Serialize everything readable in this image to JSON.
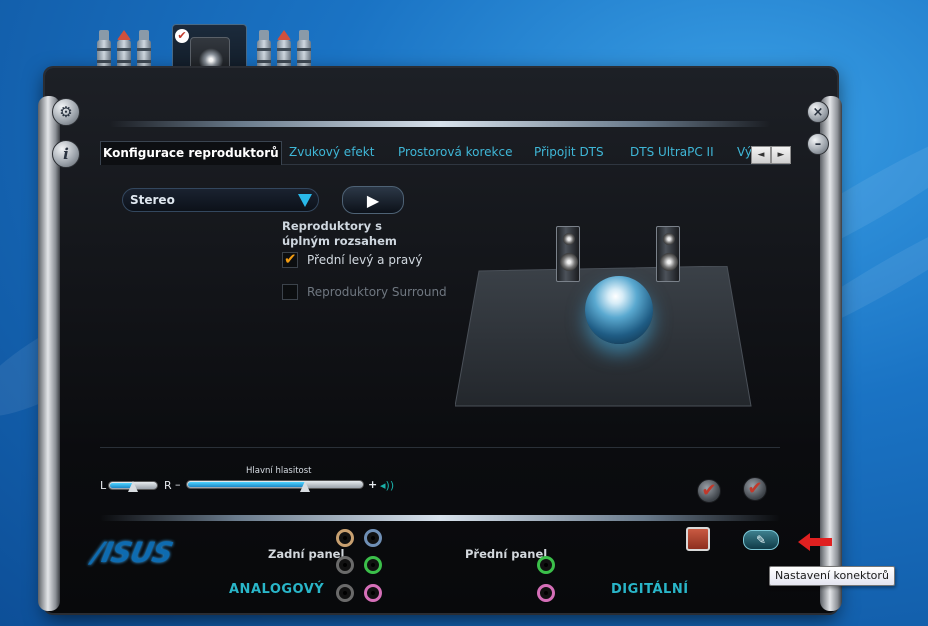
{
  "window": {
    "side_buttons_left": [
      {
        "name": "settings-gear-icon"
      },
      {
        "name": "info-icon",
        "glyph": "i"
      }
    ],
    "side_buttons_right": [
      {
        "name": "close-icon",
        "glyph": "×"
      },
      {
        "name": "minimize-icon",
        "glyph": "–"
      }
    ]
  },
  "device_strip": {
    "selected_device_icon": "speaker-icon",
    "selected_check": "✔"
  },
  "tabs": [
    {
      "label": "Konfigurace reproduktorů",
      "active": true
    },
    {
      "label": "Zvukový efekt",
      "active": false
    },
    {
      "label": "Prostorová korekce",
      "active": false
    },
    {
      "label": "Připojit DTS",
      "active": false
    },
    {
      "label": "DTS UltraPC II",
      "active": false
    },
    {
      "label": "Vý",
      "active": false
    }
  ],
  "tab_scroll": {
    "left": "◄",
    "right": "►"
  },
  "speaker_config": {
    "mode_selected": "Stereo",
    "play_glyph": "▶",
    "fullrange_label": "Reproduktory s úplným rozsahem",
    "front_lr_label": "Přední levý a pravý",
    "front_lr_checked": true,
    "surround_label": "Reproduktory Surround",
    "surround_checked": false
  },
  "volume": {
    "title": "Hlavní hlasitost",
    "left_label": "L",
    "right_label": "R",
    "minus": "–",
    "plus": "+",
    "balance_level": 0.5,
    "master_level": 0.67
  },
  "bottom": {
    "brand": "/ISUS",
    "rear_panel_label": "Zadní panel",
    "front_panel_label": "Přední panel",
    "analog_label": "ANALOGOVÝ",
    "digital_label": "DIGITÁLNÍ",
    "connector_settings_glyph": "✎",
    "tooltip": "Nastavení konektorů"
  },
  "colors": {
    "accent": "#29b9ea",
    "tab_text": "#3fb7d7",
    "jack_rear": [
      "#c8a070",
      "#6f8fb5",
      "#6a6a6a",
      "#3bbf4a",
      "#6a6a6a",
      "#d56fb8"
    ],
    "jack_front": [
      "#3bbf4a",
      "#d56fb8"
    ]
  }
}
